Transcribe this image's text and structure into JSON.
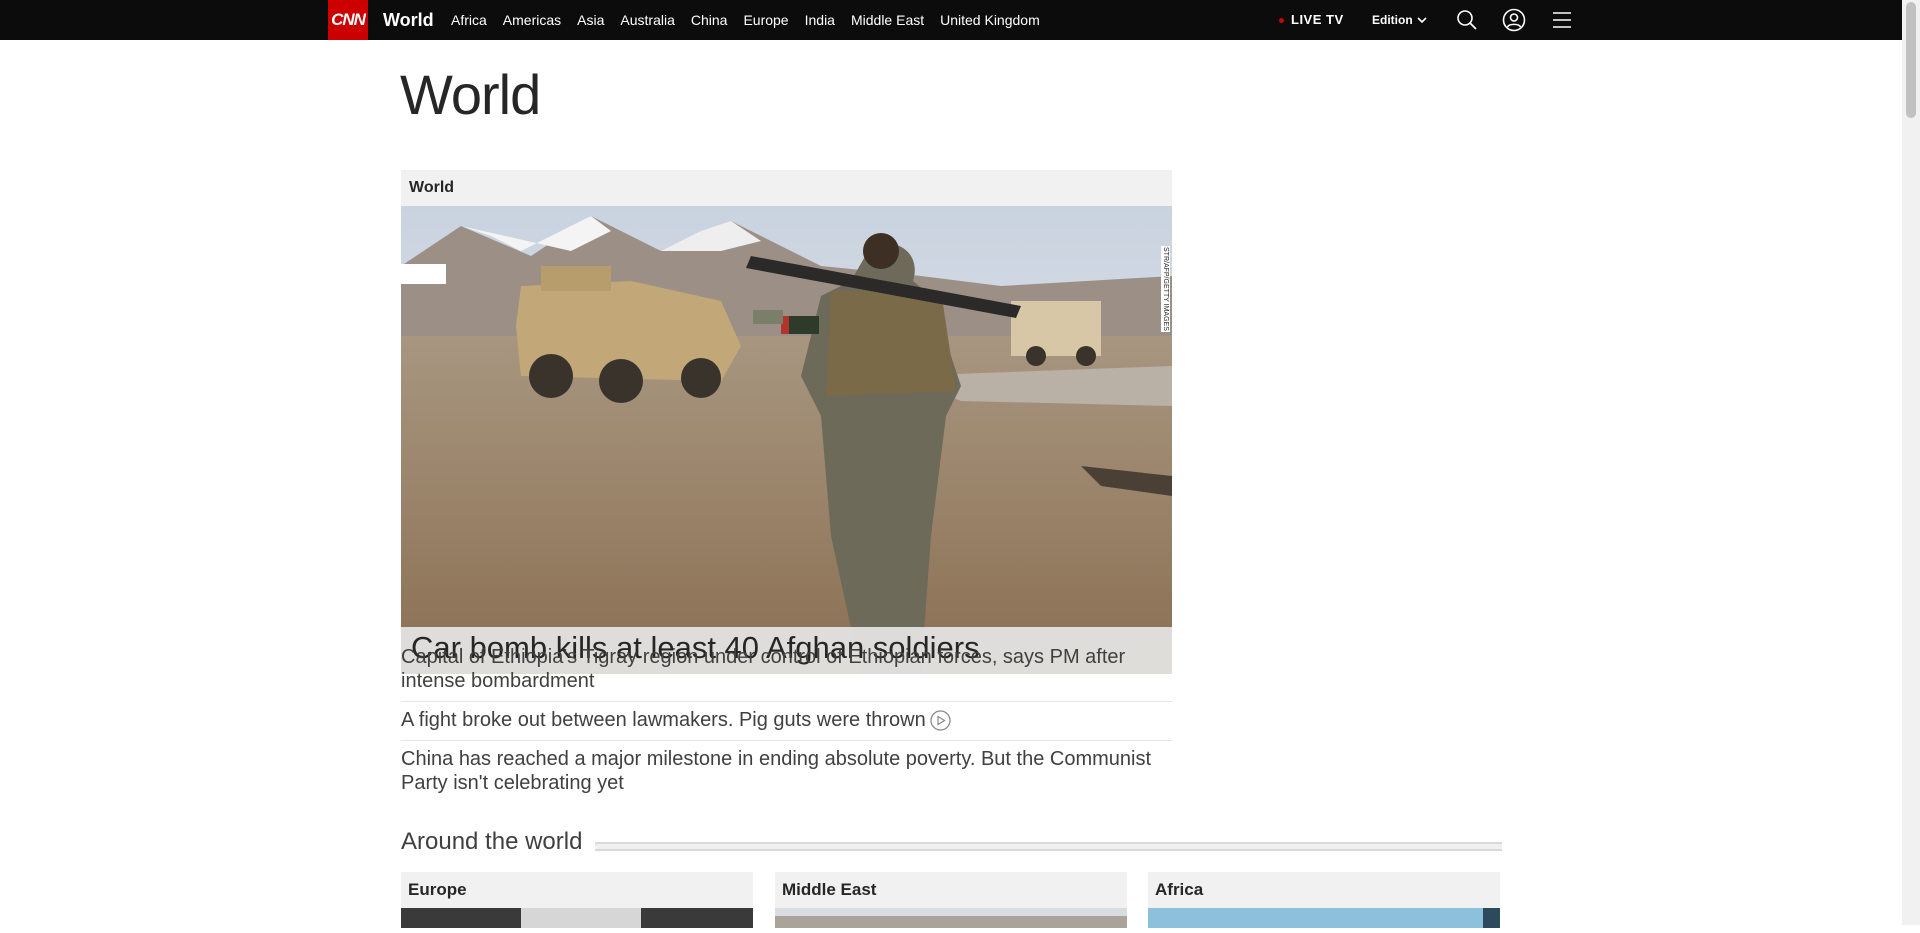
{
  "nav": {
    "logo": "CNN",
    "section": "World",
    "links": [
      "Africa",
      "Americas",
      "Asia",
      "Australia",
      "China",
      "Europe",
      "India",
      "Middle East",
      "United Kingdom"
    ],
    "live_tv": "LIVE TV",
    "edition": "Edition",
    "icons": [
      "search-icon",
      "account-icon",
      "menu-icon"
    ]
  },
  "page": {
    "title": "World"
  },
  "lead": {
    "label": "World",
    "headline": "Car bomb kills at least 40 Afghan soldiers",
    "photo_credit": "STR/AFP/GETTY IMAGES"
  },
  "stories": [
    "Capital of Ethiopia's Tigray region under control of Ethiopian forces, says PM after intense bombardment",
    "A fight broke out between lawmakers. Pig guts were thrown",
    "China has reached a major milestone in ending absolute poverty. But the Communist Party isn't celebrating yet"
  ],
  "around": {
    "title": "Around the world",
    "cards": [
      "Europe",
      "Middle East",
      "Africa"
    ]
  },
  "colors": {
    "brand": "#cc0000",
    "nav_bg": "#0c0c0c",
    "text": "#262626"
  }
}
